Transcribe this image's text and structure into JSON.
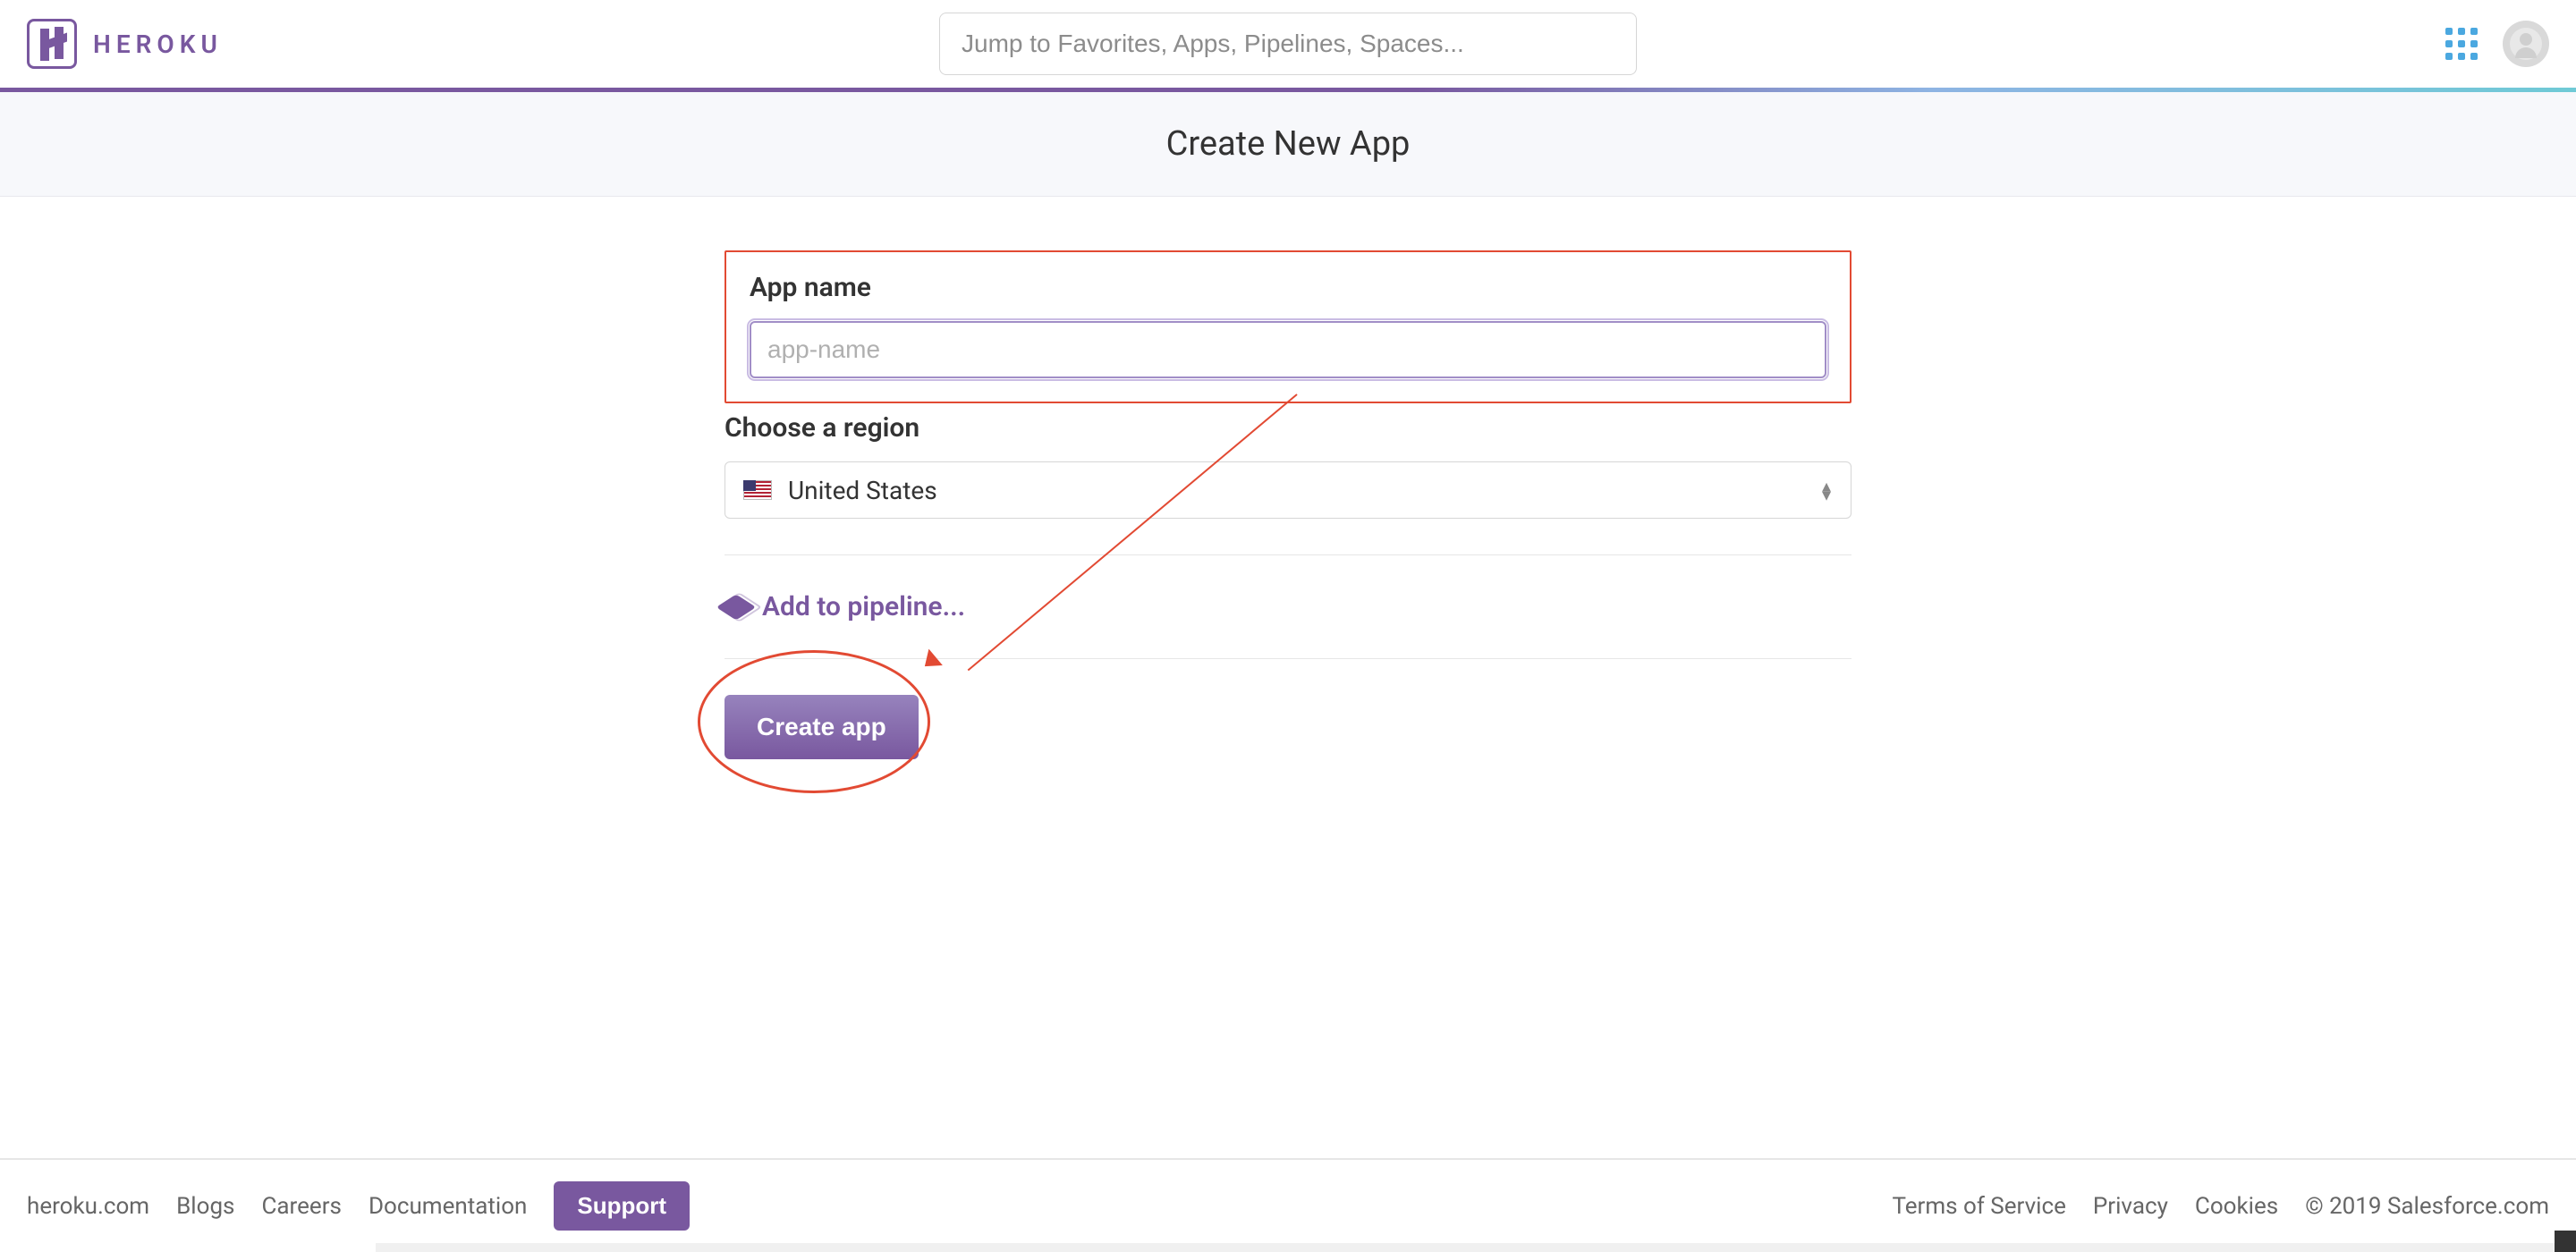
{
  "brand": {
    "name": "HEROKU"
  },
  "search": {
    "placeholder": "Jump to Favorites, Apps, Pipelines, Spaces..."
  },
  "page": {
    "title": "Create New App"
  },
  "form": {
    "app_name_label": "App name",
    "app_name_placeholder": "app-name",
    "app_name_value": "",
    "region_label": "Choose a region",
    "region_selected": "United States",
    "pipeline_label": "Add to pipeline...",
    "submit_label": "Create app"
  },
  "footer": {
    "left": [
      "heroku.com",
      "Blogs",
      "Careers",
      "Documentation"
    ],
    "support": "Support",
    "right": [
      "Terms of Service",
      "Privacy",
      "Cookies"
    ],
    "copyright": "© 2019 Salesforce.com"
  }
}
